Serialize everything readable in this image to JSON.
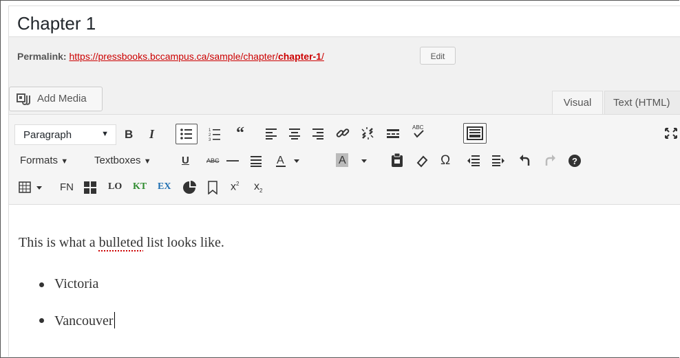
{
  "post": {
    "title": "Chapter 1",
    "permalink_label": "Permalink:",
    "permalink_base": "https://pressbooks.bccampus.ca/sample/chapter/",
    "permalink_slug": "chapter-1",
    "permalink_trailing": "/",
    "edit_label": "Edit"
  },
  "media": {
    "add_media_label": "Add Media"
  },
  "tabs": {
    "visual": "Visual",
    "text": "Text (HTML)"
  },
  "toolbar": {
    "format_select": "Paragraph",
    "formats_label": "Formats",
    "textboxes_label": "Textboxes",
    "fn_label": "FN",
    "lo_label": "LO",
    "kt_label": "KT",
    "ex_label": "EX",
    "spell_label": "ABC"
  },
  "content": {
    "paragraph_before": "This is what a ",
    "paragraph_misspelled": "bulleted",
    "paragraph_after": " list looks like.",
    "list_items": [
      "Victoria",
      "Vancouver"
    ]
  },
  "colors": {
    "link": "#cc0000",
    "kt": "#2e8b2e",
    "ex": "#1f6fb2",
    "spellcheck_underline": "#cc0000"
  }
}
